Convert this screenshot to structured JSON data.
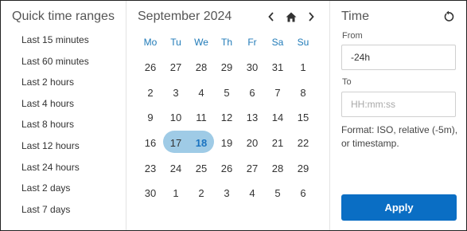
{
  "quick": {
    "title": "Quick time ranges",
    "items": [
      {
        "label": "Last 15 minutes"
      },
      {
        "label": "Last 60 minutes"
      },
      {
        "label": "Last 2 hours"
      },
      {
        "label": "Last 4 hours"
      },
      {
        "label": "Last 8 hours"
      },
      {
        "label": "Last 12 hours"
      },
      {
        "label": "Last 24 hours"
      },
      {
        "label": "Last 2 days"
      },
      {
        "label": "Last 7 days"
      }
    ]
  },
  "calendar": {
    "month_label": "September 2024",
    "weekdays": [
      "Mo",
      "Tu",
      "We",
      "Th",
      "Fr",
      "Sa",
      "Su"
    ],
    "weeks": [
      [
        "26",
        "27",
        "28",
        "29",
        "30",
        "31",
        "1"
      ],
      [
        "2",
        "3",
        "4",
        "5",
        "6",
        "7",
        "8"
      ],
      [
        "9",
        "10",
        "11",
        "12",
        "13",
        "14",
        "15"
      ],
      [
        "16",
        "17",
        "18",
        "19",
        "20",
        "21",
        "22"
      ],
      [
        "23",
        "24",
        "25",
        "26",
        "27",
        "28",
        "29"
      ],
      [
        "30",
        "1",
        "2",
        "3",
        "4",
        "5",
        "6"
      ]
    ],
    "selected_range": [
      "17",
      "18"
    ],
    "today": "18",
    "highlight_color": "#9fcbe6",
    "accent_color": "#1f7ab8",
    "icons": {
      "prev": "chevron-left-icon",
      "home": "home-icon",
      "next": "chevron-right-icon"
    }
  },
  "time": {
    "title": "Time",
    "from_label": "From",
    "from_value": "-24h",
    "to_label": "To",
    "to_placeholder": "HH:mm:ss",
    "hint": "Format: ISO, relative (-5m), or timestamp.",
    "apply_label": "Apply",
    "apply_color": "#0a6ec4",
    "reset_icon": "reset-icon"
  }
}
